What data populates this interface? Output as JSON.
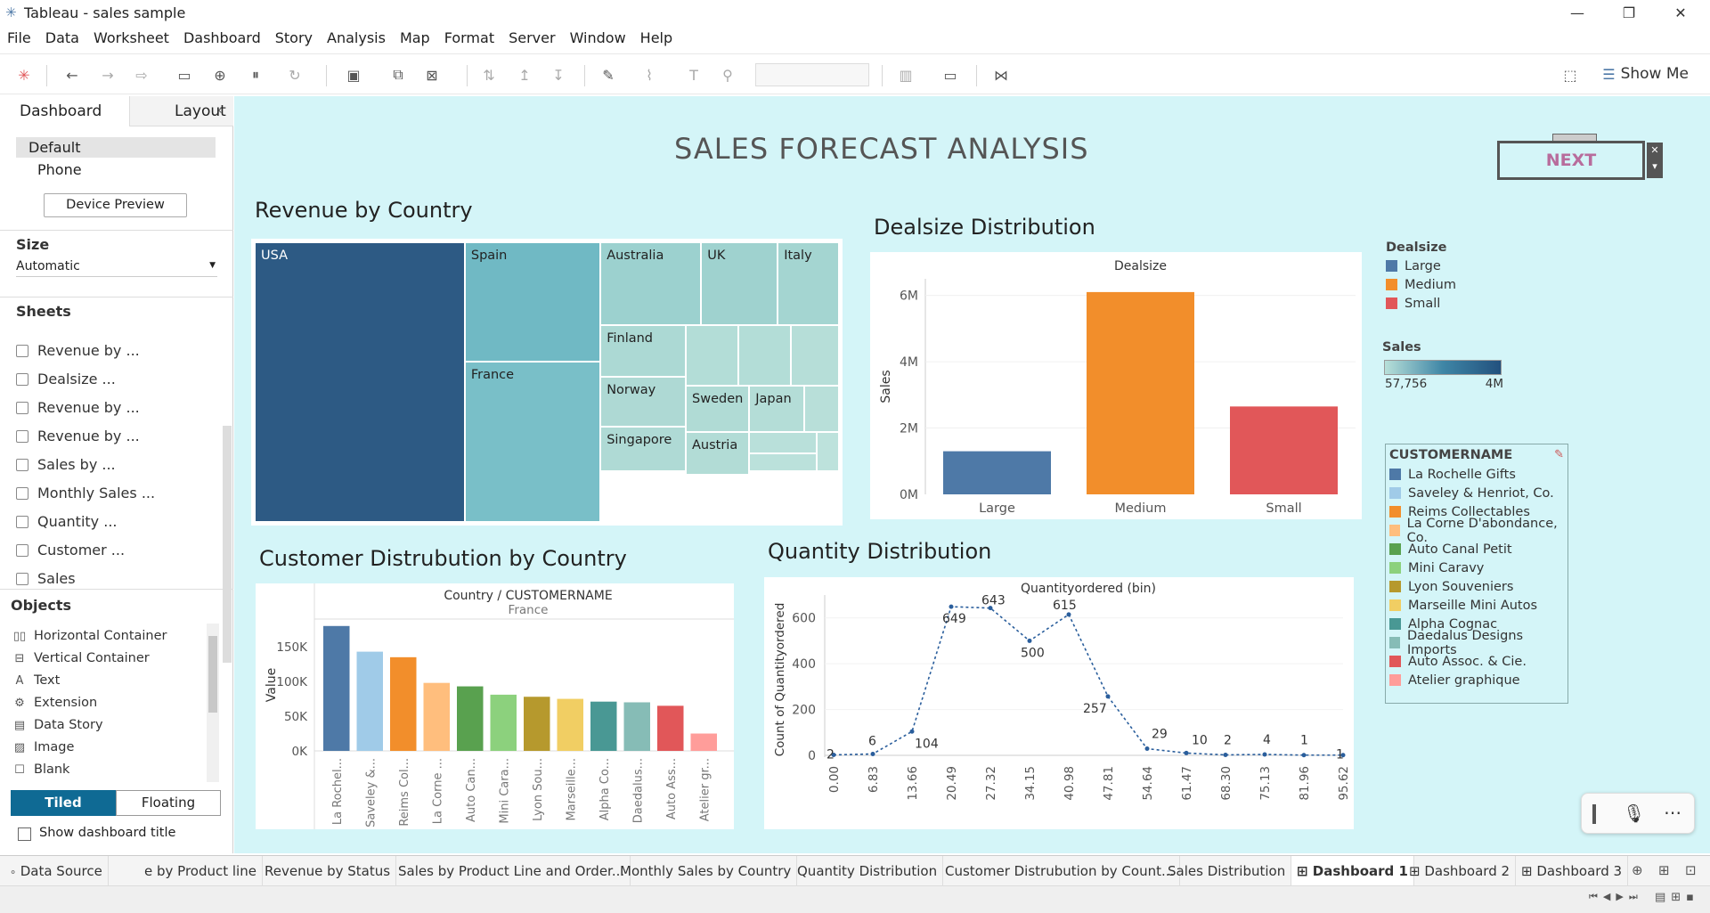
{
  "window": {
    "title": "Tableau - sales sample"
  },
  "menu": [
    "File",
    "Data",
    "Worksheet",
    "Dashboard",
    "Story",
    "Analysis",
    "Map",
    "Format",
    "Server",
    "Window",
    "Help"
  ],
  "toolbar": {
    "show_me": "Show Me"
  },
  "left_panel": {
    "tab_dashboard": "Dashboard",
    "tab_layout": "Layout",
    "devices": [
      "Default",
      "Phone"
    ],
    "device_preview": "Device Preview",
    "size_title": "Size",
    "size_value": "Automatic",
    "sheets_title": "Sheets",
    "sheets": [
      "Revenue by ...",
      "Dealsize ...",
      "Revenue by ...",
      "Revenue by ...",
      "Sales by ...",
      "Monthly Sales ...",
      "Quantity ...",
      "Customer ...",
      "Sales"
    ],
    "objects_title": "Objects",
    "objects": [
      {
        "label": "Horizontal Container",
        "icon": "horizontal-container-icon",
        "glyph": "▯▯"
      },
      {
        "label": "Vertical Container",
        "icon": "vertical-container-icon",
        "glyph": "⊟"
      },
      {
        "label": "Text",
        "icon": "text-icon",
        "glyph": "A"
      },
      {
        "label": "Extension",
        "icon": "extension-icon",
        "glyph": "⚙"
      },
      {
        "label": "Data Story",
        "icon": "data-story-icon",
        "glyph": "▤"
      },
      {
        "label": "Image",
        "icon": "image-icon",
        "glyph": "▨"
      },
      {
        "label": "Blank",
        "icon": "blank-icon",
        "glyph": "☐"
      }
    ],
    "tiled": "Tiled",
    "floating": "Floating",
    "show_title_label": "Show dashboard title"
  },
  "dashboard": {
    "title": "SALES FORECAST ANALYSIS",
    "next_button": "NEXT",
    "revenue_title": "Revenue by Country",
    "treemap": [
      "USA",
      "Spain",
      "Australia",
      "UK",
      "Italy",
      "France",
      "Finland",
      "Norway",
      "Sweden",
      "Japan",
      "Singapore",
      "Austria"
    ],
    "dealsize_title": "Dealsize Distribution",
    "customer_title": "Customer Distrubution by Country",
    "quantity_title": "Quantity Distribution",
    "legend_dealsize": {
      "title": "Dealsize",
      "items": [
        {
          "label": "Large",
          "color": "#4e79a7"
        },
        {
          "label": "Medium",
          "color": "#f28e2b"
        },
        {
          "label": "Small",
          "color": "#e15759"
        }
      ]
    },
    "legend_sales": {
      "title": "Sales",
      "min": "57,756",
      "max": "4M"
    },
    "legend_customer": {
      "title": "CUSTOMERNAME",
      "items": [
        {
          "label": "La Rochelle Gifts",
          "color": "#4e79a7"
        },
        {
          "label": "Saveley & Henriot, Co.",
          "color": "#a0cbe8"
        },
        {
          "label": "Reims Collectables",
          "color": "#f28e2b"
        },
        {
          "label": "La Corne D'abondance, Co.",
          "color": "#ffbe7d"
        },
        {
          "label": "Auto Canal Petit",
          "color": "#59a14f"
        },
        {
          "label": "Mini Caravy",
          "color": "#8cd17d"
        },
        {
          "label": "Lyon Souveniers",
          "color": "#b6992d"
        },
        {
          "label": "Marseille Mini Autos",
          "color": "#f1ce63"
        },
        {
          "label": "Alpha Cognac",
          "color": "#499894"
        },
        {
          "label": "Daedalus Designs Imports",
          "color": "#86bcb6"
        },
        {
          "label": "Auto Assoc. & Cie.",
          "color": "#e15759"
        },
        {
          "label": "Atelier graphique",
          "color": "#ff9d9a"
        }
      ]
    }
  },
  "chart_data": [
    {
      "type": "bar",
      "title": "Dealsize",
      "categories": [
        "Large",
        "Medium",
        "Small"
      ],
      "values": [
        1300000,
        6100000,
        2650000
      ],
      "colors": [
        "#4e79a7",
        "#f28e2b",
        "#e15759"
      ],
      "ylabel": "Sales",
      "yticks": [
        "0M",
        "2M",
        "4M",
        "6M"
      ],
      "ylim": [
        0,
        6500000
      ]
    },
    {
      "type": "bar",
      "title": "Country / CUSTOMERNAME",
      "subtitle": "France",
      "categories": [
        "La Rochel...",
        "Saveley &...",
        "Reims Col...",
        "La Corne ...",
        "Auto Can...",
        "Mini Cara...",
        "Lyon Sou...",
        "Marseille...",
        "Alpha Co...",
        "Daedalus...",
        "Auto Ass...",
        "Atelier gr..."
      ],
      "values": [
        180000,
        143000,
        135000,
        98000,
        93000,
        81000,
        78000,
        75000,
        71000,
        70000,
        65000,
        25000
      ],
      "colors": [
        "#4e79a7",
        "#a0cbe8",
        "#f28e2b",
        "#ffbe7d",
        "#59a14f",
        "#8cd17d",
        "#b6992d",
        "#f1ce63",
        "#499894",
        "#86bcb6",
        "#e15759",
        "#ff9d9a"
      ],
      "ylabel": "Value",
      "yticks": [
        "0K",
        "50K",
        "100K",
        "150K"
      ],
      "ylim": [
        0,
        190000
      ]
    },
    {
      "type": "line",
      "title": "Quantityordered (bin)",
      "x": [
        "0.00",
        "6.83",
        "13.66",
        "20.49",
        "27.32",
        "34.15",
        "40.98",
        "47.81",
        "54.64",
        "61.47",
        "68.30",
        "75.13",
        "81.96",
        "95.62"
      ],
      "values": [
        2,
        6,
        104,
        649,
        643,
        500,
        615,
        257,
        29,
        10,
        2,
        4,
        1,
        1
      ],
      "ylabel": "Count of Quantityordered",
      "yticks": [
        "0",
        "200",
        "400",
        "600"
      ],
      "ylim": [
        0,
        700
      ]
    },
    {
      "type": "treemap",
      "title": "Revenue by Country",
      "categories": [
        "USA",
        "Spain",
        "Australia",
        "UK",
        "Italy",
        "France",
        "Finland",
        "Norway",
        "Sweden",
        "Japan",
        "Singapore",
        "Austria"
      ]
    }
  ]
}
